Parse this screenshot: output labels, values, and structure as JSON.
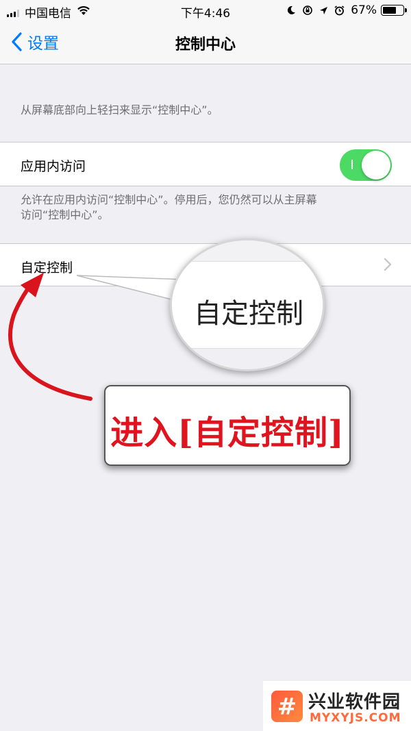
{
  "status_bar": {
    "carrier": "中国电信",
    "time": "下午4:46",
    "battery": "67%",
    "battery_level": 0.67,
    "icons": [
      "signal-icon",
      "wifi-icon",
      "moon-icon",
      "orientation-lock-icon",
      "location-icon",
      "alarm-icon",
      "battery-icon"
    ]
  },
  "nav": {
    "back_label": "设置",
    "title": "控制中心"
  },
  "content": {
    "intro_text": "从屏幕底部向上轻扫来显示“控制中心”。",
    "access_within_apps": {
      "label": "应用内访问",
      "enabled": true,
      "footer_line1": "允许在应用内访问“控制中心”。停用后，您仍然可以从主屏幕",
      "footer_line2": "访问“控制中心”。"
    },
    "customize_controls": {
      "label": "自定控制"
    }
  },
  "annotation": {
    "magnifier_text": "自定控制",
    "callout_text": "进入[自定控制]",
    "callout_color": "#e0141f",
    "arrow_color": "#d9141c"
  },
  "watermark": {
    "logo_glyph": "#",
    "name": "兴业软件园",
    "url": "MYXYJS.COM"
  },
  "colors": {
    "accent": "#007aff",
    "toggle_on": "#4cd964",
    "background": "#efeff4"
  }
}
